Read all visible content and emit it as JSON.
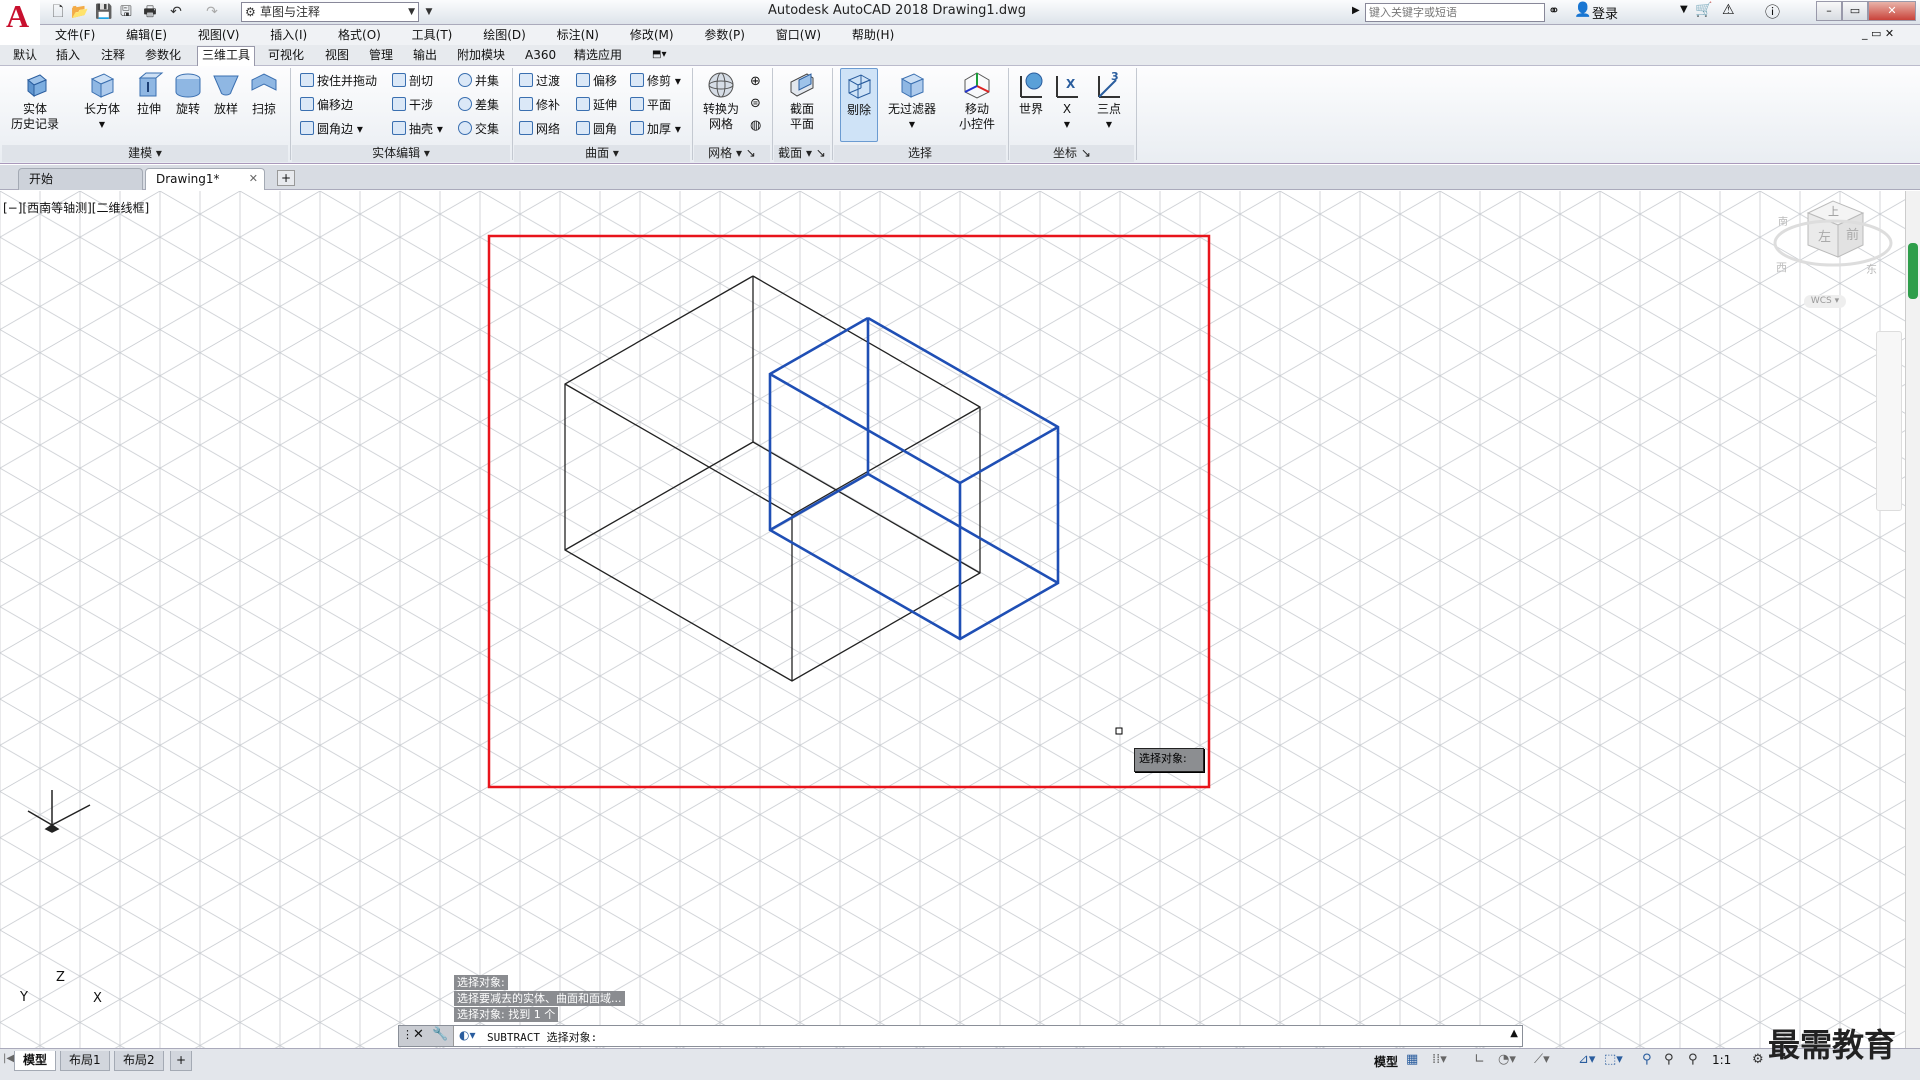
{
  "title_bar": {
    "app_title": "Autodesk AutoCAD 2018    Drawing1.dwg",
    "workspace": "草图与注释",
    "search_placeholder": "键入关键字或短语",
    "login_label": "登录"
  },
  "menu": [
    "文件(F)",
    "编辑(E)",
    "视图(V)",
    "插入(I)",
    "格式(O)",
    "工具(T)",
    "绘图(D)",
    "标注(N)",
    "修改(M)",
    "参数(P)",
    "窗口(W)",
    "帮助(H)"
  ],
  "ribbon_tabs": [
    "默认",
    "插入",
    "注释",
    "参数化",
    "三维工具",
    "可视化",
    "视图",
    "管理",
    "输出",
    "附加模块",
    "A360",
    "精选应用"
  ],
  "active_ribbon_tab": "三维工具",
  "ribbon": {
    "solid_history": {
      "line1": "实体",
      "line2": "历史记录"
    },
    "modeling_buttons": [
      "长方体",
      "拉伸",
      "旋转",
      "放样",
      "扫掠"
    ],
    "modeling_panel": "建模",
    "solid_edit_items": [
      "按住并拖动",
      "剖切",
      "并集",
      "偏移边",
      "干涉",
      "差集",
      "圆角边",
      "抽壳",
      "交集"
    ],
    "solid_edit_panel": "实体编辑",
    "surface_items": [
      "过渡",
      "偏移",
      "修剪",
      "修补",
      "延伸",
      "平面",
      "网络",
      "圆角",
      "加厚"
    ],
    "surface_panel": "曲面",
    "mesh_button": {
      "line1": "转换为",
      "line2": "网格"
    },
    "mesh_panel": "网格",
    "section_button": {
      "line1": "截面",
      "line2": "平面"
    },
    "section_panel": "截面",
    "remove_button": "剔除",
    "no_filter_button": "无过滤器",
    "gizmo_button": {
      "line1": "移动",
      "line2": "小控件"
    },
    "selection_panel": "选择",
    "coord_buttons": [
      "世界",
      "X",
      "三点"
    ],
    "coord_panel": "坐标"
  },
  "file_tabs": {
    "start": "开始",
    "drawing": "Drawing1*",
    "plus": "+"
  },
  "view_label": "[−][西南等轴测][二维线框]",
  "viewcube": {
    "top": "上",
    "left": "左",
    "front": "前",
    "south": "南",
    "west": "西",
    "east": "东",
    "wcs": "WCS"
  },
  "ucs": {
    "x": "X",
    "y": "Y",
    "z": "Z"
  },
  "tooltip": "选择对象:",
  "command_history": [
    "选择对象:",
    "选择要减去的实体、曲面和面域...",
    "选择对象: 找到 1 个"
  ],
  "command_line": "SUBTRACT 选择对象:",
  "layout_tabs": [
    "模型",
    "布局1",
    "布局2",
    "+"
  ],
  "status": {
    "model": "模型",
    "scale": "1:1"
  },
  "watermark": "最需教育",
  "colors": {
    "selection_rect": "#e8141b",
    "selected_box": "#1f4fb5",
    "accent": "#c8102e"
  }
}
